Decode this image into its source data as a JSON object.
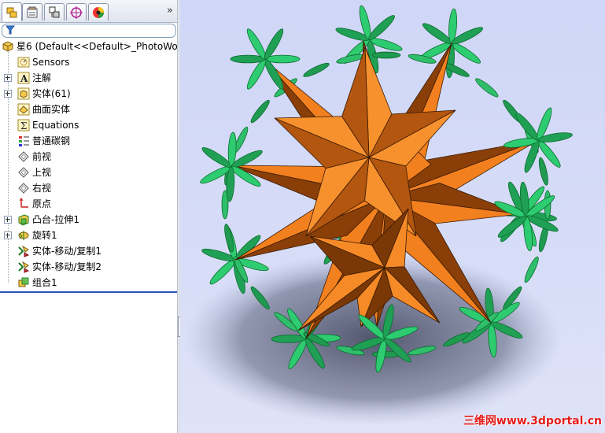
{
  "feature_manager": {
    "root": "星6  (Default<<Default>_PhotoWor",
    "items": [
      {
        "label": "Sensors",
        "icon": "sensors-icon",
        "expandable": false
      },
      {
        "label": "注解",
        "icon": "annotations-icon",
        "expandable": true
      },
      {
        "label": "实体(61)",
        "icon": "solid-bodies-icon",
        "expandable": true
      },
      {
        "label": "曲面实体",
        "icon": "surface-bodies-icon",
        "expandable": false
      },
      {
        "label": "Equations",
        "icon": "equations-icon",
        "expandable": false
      },
      {
        "label": "普通碳钢",
        "icon": "material-icon",
        "expandable": false
      },
      {
        "label": "前视",
        "icon": "plane-icon",
        "expandable": false
      },
      {
        "label": "上视",
        "icon": "plane-icon",
        "expandable": false
      },
      {
        "label": "右视",
        "icon": "plane-icon",
        "expandable": false
      },
      {
        "label": "原点",
        "icon": "origin-icon",
        "expandable": false
      },
      {
        "label": "凸台-拉伸1",
        "icon": "boss-extrude-icon",
        "expandable": true
      },
      {
        "label": "旋转1",
        "icon": "revolve-icon",
        "expandable": true
      },
      {
        "label": "实体-移动/复制1",
        "icon": "move-copy-icon",
        "expandable": false
      },
      {
        "label": "实体-移动/复制2",
        "icon": "move-copy-icon",
        "expandable": false
      },
      {
        "label": "组合1",
        "icon": "combine-icon",
        "expandable": false
      }
    ]
  },
  "tabs": [
    {
      "name": "featuremanager-tab",
      "icon": "feature-tree-icon"
    },
    {
      "name": "propertymanager-tab",
      "icon": "property-icon"
    },
    {
      "name": "configurationmanager-tab",
      "icon": "configuration-icon"
    },
    {
      "name": "dimxpert-tab",
      "icon": "target-icon"
    },
    {
      "name": "display-manager-tab",
      "icon": "appearance-icon"
    }
  ],
  "expand_label": "»",
  "watermark": "三维网www.3dportal.cn",
  "colors": {
    "viewport_bg": "#d3daf7",
    "star_orange": "#f2801f",
    "star_dark": "#8a3f08",
    "leaf_green": "#2ecc71",
    "leaf_dark": "#0b6b2e",
    "rollback_bar": "#2a57b8",
    "watermark": "#e51a1a"
  }
}
